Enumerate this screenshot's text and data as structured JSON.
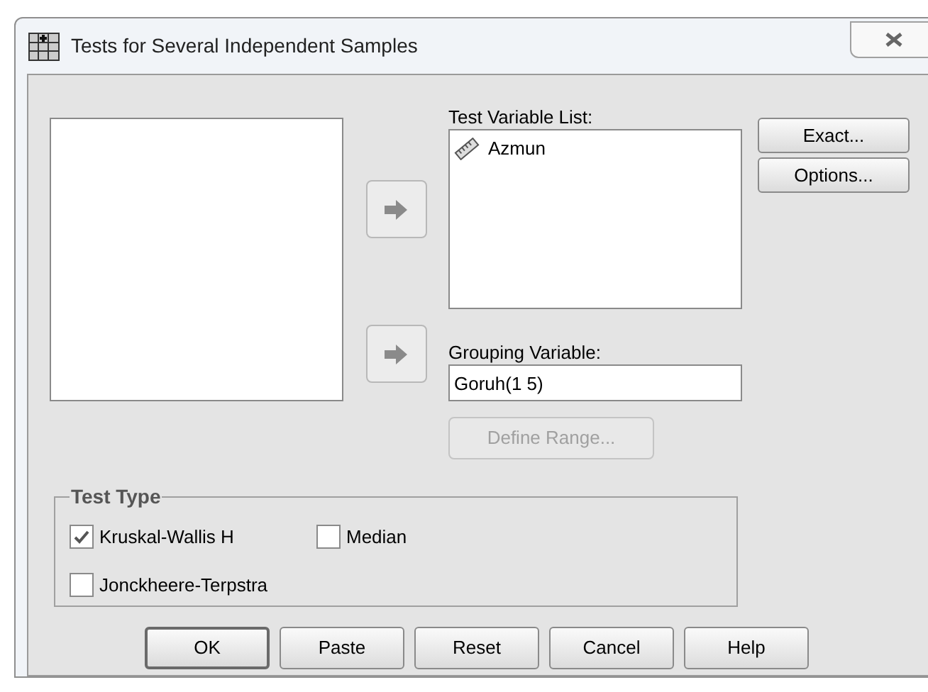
{
  "window": {
    "title": "Tests for Several Independent Samples"
  },
  "test_variable_list": {
    "label": "Test Variable List:",
    "items": [
      {
        "name": "Azmun"
      }
    ]
  },
  "grouping_variable": {
    "label": "Grouping Variable:",
    "value": "Goruh(1 5)"
  },
  "define_range_button": {
    "label": "Define Range...",
    "disabled": true
  },
  "side_buttons": [
    "Exact...",
    "Options..."
  ],
  "test_type": {
    "title": "Test Type",
    "options": [
      {
        "label": "Kruskal-Wallis H",
        "checked": true
      },
      {
        "label": "Median",
        "checked": false
      },
      {
        "label": "Jonckheere-Terpstra",
        "checked": false
      }
    ]
  },
  "buttons": [
    {
      "label": "OK",
      "default": true
    },
    {
      "label": "Paste",
      "default": false
    },
    {
      "label": "Reset",
      "default": false
    },
    {
      "label": "Cancel",
      "default": false
    },
    {
      "label": "Help",
      "default": false
    }
  ]
}
